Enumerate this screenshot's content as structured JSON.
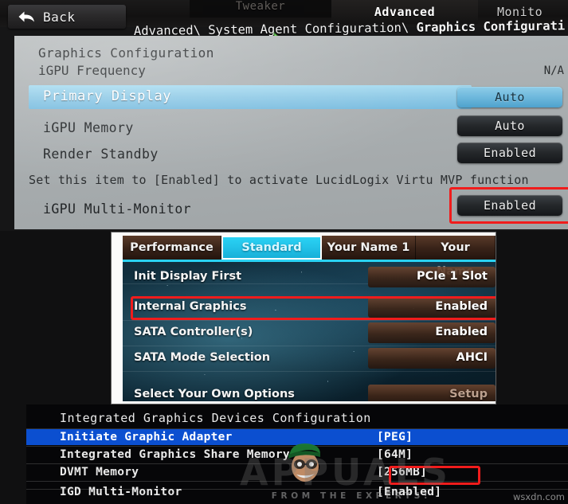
{
  "panel1": {
    "name": "gigabyte-uefi-graphics-configuration",
    "back_label": "Back",
    "back_icon": "back-arrow-icon",
    "cursor_icon": "mouse-cursor-icon",
    "tabs": [
      {
        "label": "Tweaker",
        "active": false
      },
      {
        "label": "Advanced",
        "active": true
      },
      {
        "label": "Monito",
        "active": false
      }
    ],
    "breadcrumb": "Advanced\\ System Agent Configuration\\ Graphics Configurati",
    "breadcrumb_plain": "Advanced\\ System Agent Configuration\\ ",
    "breadcrumb_bold": "Graphics Configurati",
    "header": "Graphics Configuration",
    "subheader": "iGPU Frequency",
    "na_value": "N/A",
    "rows": [
      {
        "label": "Primary Display",
        "value": "Auto",
        "selected": true,
        "highlight_box": false
      },
      {
        "label": "iGPU Memory",
        "value": "Auto",
        "selected": false,
        "highlight_box": false
      },
      {
        "label": "Render Standby",
        "value": "Enabled",
        "selected": false,
        "highlight_box": false
      },
      {
        "label": "iGPU Multi-Monitor",
        "value": "Enabled",
        "selected": false,
        "highlight_box": true
      }
    ],
    "help_text": "Set this item to [Enabled] to activate LucidLogix Virtu MVP function"
  },
  "panel2": {
    "name": "asus-uefi-ez-mode",
    "tabs": [
      {
        "label": "Performance",
        "active": false
      },
      {
        "label": "Standard",
        "active": true
      },
      {
        "label": "Your Name 1",
        "active": false
      },
      {
        "label": "Your Name",
        "active": false
      }
    ],
    "rows": [
      {
        "label": "Init Display First",
        "value": "PCIe 1 Slot",
        "highlight_box": false
      },
      {
        "label": "Internal Graphics",
        "value": "Enabled",
        "highlight_box": true
      },
      {
        "label": "SATA Controller(s)",
        "value": "Enabled",
        "highlight_box": false
      },
      {
        "label": "SATA Mode Selection",
        "value": "AHCI",
        "highlight_box": false
      },
      {
        "label": "Select Your Own Options",
        "value": "Setup",
        "highlight_box": false
      }
    ]
  },
  "panel3": {
    "name": "ami-bios-integrated-graphics",
    "header": "Integrated Graphics Devices Configuration",
    "rows": [
      {
        "label": "Initiate Graphic Adapter",
        "value": "[PEG]",
        "selected": true,
        "highlight_box": false
      },
      {
        "label": "Integrated Graphics Share Memory",
        "value": "[64M]",
        "selected": false,
        "highlight_box": false
      },
      {
        "label": "DVMT Memory",
        "value": "[256MB]",
        "selected": false,
        "highlight_box": false
      },
      {
        "label": "IGD Multi-Monitor",
        "value": "[Enabled]",
        "selected": false,
        "highlight_box": true
      }
    ]
  },
  "watermarks": {
    "brand": "APPUALS",
    "tagline": "FROM THE EXPERTS!",
    "site": "wsxdn.com",
    "face_icon": "appuals-mascot-icon"
  },
  "colors": {
    "highlight_red": "#f01c1c",
    "uefi_blue_select": "#8ec9e6",
    "asus_cyan": "#2ad2f4",
    "ami_blue_select": "#0b4fd0"
  }
}
